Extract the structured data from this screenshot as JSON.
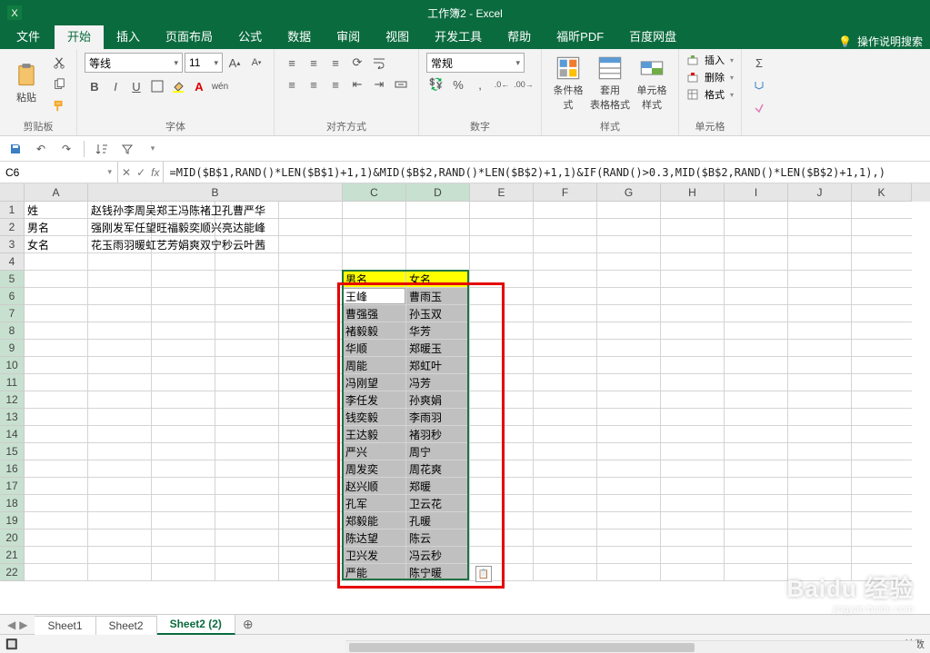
{
  "app": {
    "title": "工作簿2 - Excel"
  },
  "tabs": {
    "file": "文件",
    "home": "开始",
    "insert": "插入",
    "layout": "页面布局",
    "formulas": "公式",
    "data": "数据",
    "review": "审阅",
    "view": "视图",
    "dev": "开发工具",
    "help": "帮助",
    "foxit": "福昕PDF",
    "baidu": "百度网盘",
    "tell_me": "操作说明搜索"
  },
  "ribbon": {
    "clipboard": {
      "label": "剪贴板",
      "paste": "粘贴"
    },
    "font": {
      "label": "字体",
      "name": "等线",
      "size": "11"
    },
    "alignment": {
      "label": "对齐方式"
    },
    "number": {
      "label": "数字",
      "format": "常规"
    },
    "styles": {
      "label": "样式",
      "cond": "条件格式",
      "table": "套用\n表格格式",
      "cell": "单元格样式"
    },
    "cells": {
      "label": "单元格",
      "insert": "插入",
      "delete": "删除",
      "format": "格式"
    },
    "editing": {
      "label": ""
    }
  },
  "nameBox": "C6",
  "formula": "=MID($B$1,RAND()*LEN($B$1)+1,1)&MID($B$2,RAND()*LEN($B$2)+1,1)&IF(RAND()>0.3,MID($B$2,RAND()*LEN($B$2)+1,1),)",
  "columns": [
    "A",
    "B",
    "C",
    "D",
    "E",
    "F",
    "G",
    "H",
    "I",
    "J",
    "K"
  ],
  "colWidths": {
    "A": 70,
    "B": 280,
    "C": 70,
    "D": 70,
    "E": 70,
    "F": 70,
    "G": 70,
    "H": 70,
    "I": 70,
    "J": 70,
    "K": 66
  },
  "rowCount": 22,
  "data": {
    "A1": "姓",
    "B1": "赵钱孙李周吴郑王冯陈褚卫孔曹严华",
    "A2": "男名",
    "B2": "强刚发军任望旺福毅奕顺兴亮达能峰",
    "A3": "女名",
    "B3": "花玉雨羽暖虹艺芳娟爽双宁秒云叶茜",
    "C5": "男名",
    "D5": "女名",
    "C6": "王峰",
    "D6": "曹雨玉",
    "C7": "曹强强",
    "D7": "孙玉双",
    "C8": "褚毅毅",
    "D8": "华芳",
    "C9": "华顺",
    "D9": "郑暖玉",
    "C10": "周能",
    "D10": "郑虹叶",
    "C11": "冯刚望",
    "D11": "冯芳",
    "C12": "李任发",
    "D12": "孙爽娟",
    "C13": "钱奕毅",
    "D13": "李雨羽",
    "C14": "王达毅",
    "D14": "褚羽秒",
    "C15": "严兴",
    "D15": "周宁",
    "C16": "周发奕",
    "D16": "周花爽",
    "C17": "赵兴顺",
    "D17": "郑暖",
    "C18": "孔军",
    "D18": "卫云花",
    "C19": "郑毅能",
    "D19": "孔暖",
    "C20": "陈达望",
    "D20": "陈云",
    "C21": "卫兴发",
    "D21": "冯云秒",
    "C22": "严能",
    "D22": "陈宁暖"
  },
  "yellowCells": [
    "C5",
    "D5"
  ],
  "greyRange": {
    "c1": "C",
    "r1": 6,
    "c2": "D",
    "r2": 22
  },
  "selection": {
    "c1": "C",
    "r1": 5,
    "c2": "D",
    "r2": 22
  },
  "activeCell": "C6",
  "sheets": [
    "Sheet1",
    "Sheet2",
    "Sheet2 (2)"
  ],
  "activeSheet": 2,
  "status": {
    "count_label": "计数"
  },
  "watermark": {
    "brand": "Baidu 经验",
    "url": "jingyan.baidu.com"
  }
}
